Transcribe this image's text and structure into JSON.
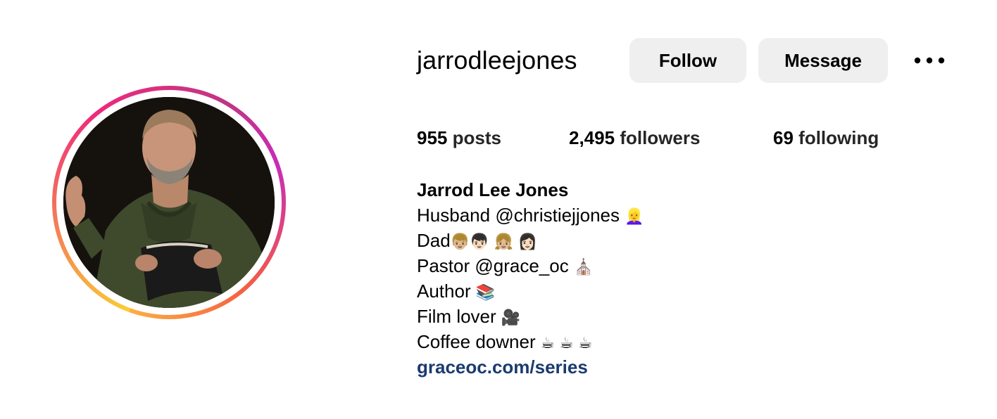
{
  "profile": {
    "username": "jarrodleejones",
    "full_name": "Jarrod Lee Jones"
  },
  "actions": {
    "follow_label": "Follow",
    "message_label": "Message",
    "more_icon": "more-horizontal-icon"
  },
  "stats": {
    "posts_count": "955",
    "posts_label": "posts",
    "followers_count": "2,495",
    "followers_label": "followers",
    "following_count": "69",
    "following_label": "following"
  },
  "bio": {
    "line1_text": "Husband ",
    "line1_mention": "@christiejjones",
    "line1_emoji": "👱‍♀️",
    "line2_text": "Dad",
    "line2_emoji": "👦🏼👦🏻 👧🏼 👩🏻",
    "line3_text": "Pastor ",
    "line3_mention": "@grace_oc",
    "line3_emoji": "⛪",
    "line4_text": "Author",
    "line4_emoji": "📚",
    "line5_text": "Film lover",
    "line5_emoji": "🎥",
    "line6_text": "Coffee downer",
    "line6_emoji": "☕ ☕ ☕",
    "link": "graceoc.com/series"
  },
  "colors": {
    "button_bg": "#efefef",
    "link": "#1b3b6f",
    "story_ring_start": "#f9ce34",
    "story_ring_mid": "#ee2a7b",
    "story_ring_end": "#c92bb7"
  }
}
